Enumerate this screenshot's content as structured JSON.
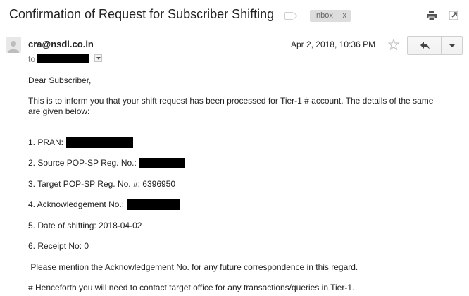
{
  "email": {
    "subject": "Confirmation of Request for Subscriber Shifting",
    "label_chip": "Inbox",
    "label_remove": "x",
    "sender": "cra@nsdl.co.in",
    "to_prefix": "to",
    "date": "Apr 2, 2018, 10:36 PM"
  },
  "body": {
    "greeting": "Dear Subscriber,",
    "intro": "This is to inform you that your shift request has been processed for Tier-1 # account. The details of the same are given below:",
    "item1": "1. PRAN:",
    "item2": "2. Source POP-SP Reg. No.:",
    "item3": "3. Target POP-SP Reg. No. #: 6396950",
    "item4": "4. Acknowledgement No.:",
    "item5": "5. Date of shifting: 2018-04-02",
    "item6": "6. Receipt No: 0",
    "note": " Please mention the Acknowledgement No. for any future correspondence in this regard.",
    "footer": "# Henceforth you will need to contact target office for any transactions/queries in Tier-1."
  },
  "icons": {
    "label": "label-icon",
    "print": "print-icon",
    "new_window": "new-window-icon",
    "star": "star-icon",
    "reply": "reply-icon",
    "more": "chevron-down-icon",
    "avatar": "avatar-icon"
  }
}
